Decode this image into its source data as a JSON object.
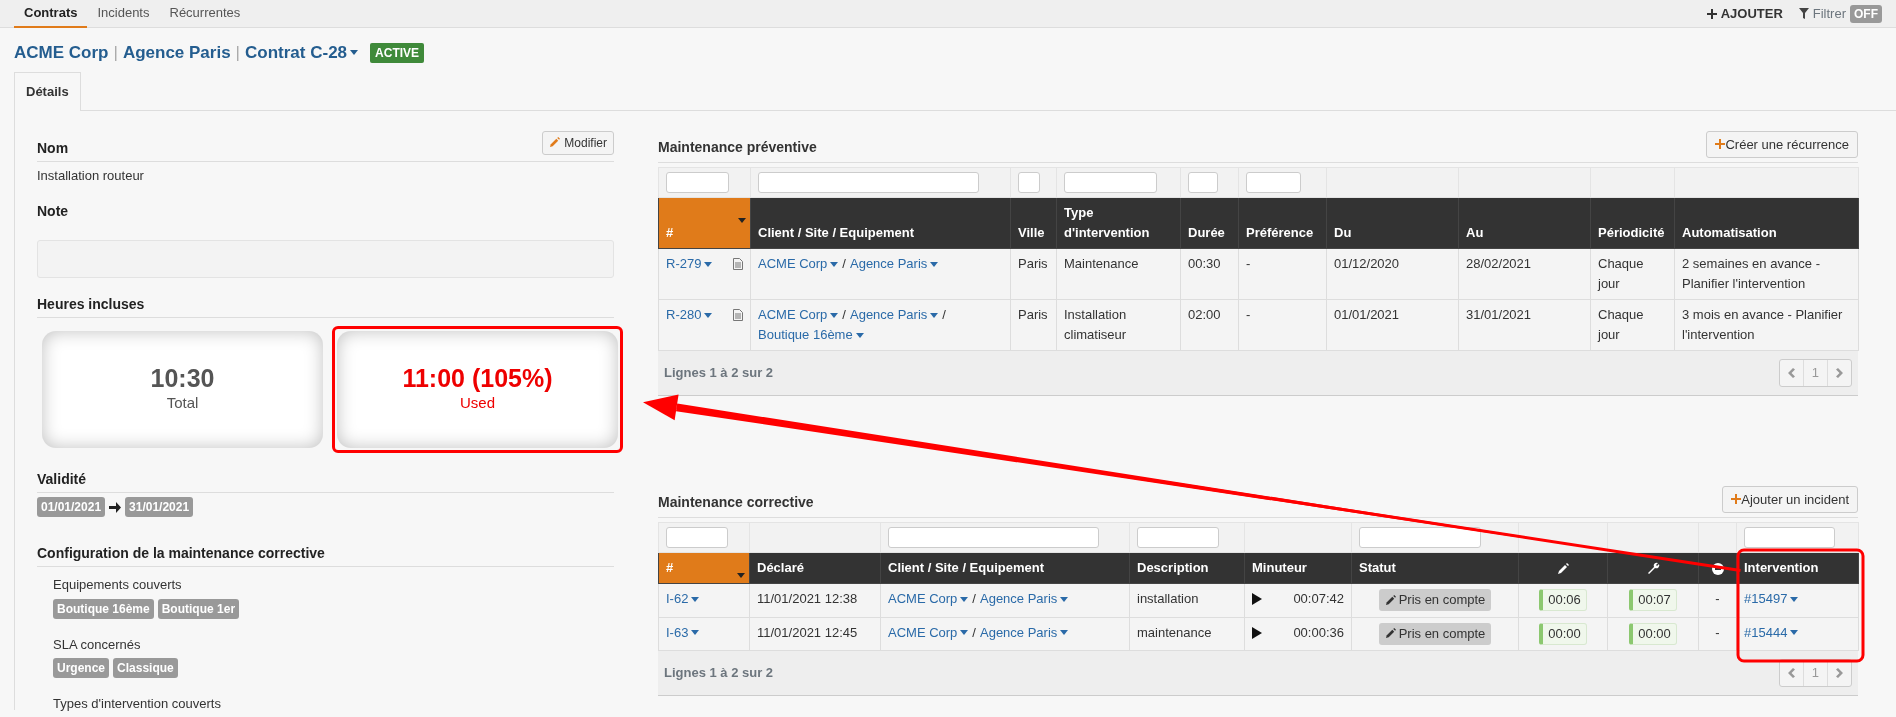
{
  "top_nav": {
    "tabs": [
      {
        "label": "Contrats",
        "selected": true
      },
      {
        "label": "Incidents",
        "selected": false
      },
      {
        "label": "Récurrentes",
        "selected": false
      }
    ],
    "add_button": "AJOUTER",
    "filter": {
      "label": "Filtrer",
      "on": false,
      "toggle_text": "OFF"
    }
  },
  "breadcrumb": {
    "items": [
      "ACME Corp",
      "Agence Paris",
      "Contrat C-28"
    ],
    "separator": "|",
    "status": "ACTIVE"
  },
  "detail_tabs": [
    {
      "label": "Détails",
      "selected": true
    }
  ],
  "details": {
    "name_label": "Nom",
    "edit_button": "Modifier",
    "name": "Installation routeur",
    "note_label": "Note",
    "hours_label": "Heures incluses",
    "hours": [
      {
        "value": "10:30",
        "caption": "Total",
        "over": false,
        "highlighted": false
      },
      {
        "value": "11:00 (105%)",
        "caption": "Used",
        "over": true,
        "highlighted": true
      }
    ],
    "validity_label": "Validité",
    "validity": {
      "start": "01/01/2021",
      "end": "31/01/2021"
    },
    "config_label": "Configuration de la maintenance corrective",
    "config_groups": [
      {
        "label": "Equipements couverts",
        "tags": [
          "Boutique 16ème",
          "Boutique 1er"
        ]
      },
      {
        "label": "SLA concernés",
        "tags": [
          "Urgence",
          "Classique"
        ]
      },
      {
        "label": "Types d'intervention couverts"
      }
    ]
  },
  "preventive": {
    "title": "Maintenance préventive",
    "action_button": "Créer une récurrence",
    "path_separator": "/",
    "columns": [
      {
        "kind": "text",
        "label": "#",
        "filter": true,
        "sorted": true
      },
      {
        "kind": "text",
        "label": "Client / Site / Equipement",
        "filter": true,
        "sorted": false
      },
      {
        "kind": "text",
        "label": "Ville",
        "filter": true,
        "sorted": false
      },
      {
        "kind": "text",
        "label": "Type d'intervention",
        "filter": true,
        "sorted": false
      },
      {
        "kind": "text",
        "label": "Durée",
        "filter": true,
        "sorted": false
      },
      {
        "kind": "text",
        "label": "Préférence",
        "filter": true,
        "sorted": false
      },
      {
        "kind": "text",
        "label": "Du",
        "filter": false,
        "sorted": false
      },
      {
        "kind": "text",
        "label": "Au",
        "filter": false,
        "sorted": false
      },
      {
        "kind": "text",
        "label": "Périodicité",
        "filter": false,
        "sorted": false
      },
      {
        "kind": "text",
        "label": "Automatisation",
        "filter": false,
        "sorted": false
      }
    ],
    "rows": [
      {
        "id": "R-279",
        "client": [
          "ACME Corp",
          "Agence Paris"
        ],
        "city": "Paris",
        "type": "Maintenance",
        "duration": "00:30",
        "preference": "-",
        "from": "01/12/2020",
        "to": "28/02/2021",
        "periodicity": "Chaque jour",
        "automation": "2 semaines en avance - Planifier l'intervention"
      },
      {
        "id": "R-280",
        "client": [
          "ACME Corp",
          "Agence Paris",
          "Boutique 16ème"
        ],
        "city": "Paris",
        "type": "Installation climatiseur",
        "duration": "02:00",
        "preference": "-",
        "from": "01/01/2021",
        "to": "31/01/2021",
        "periodicity": "Chaque jour",
        "automation": "3 mois en avance - Planifier l'intervention"
      }
    ],
    "footer": "Lignes 1 à 2 sur 2",
    "page": "1"
  },
  "corrective": {
    "title": "Maintenance corrective",
    "action_button": "Ajouter un incident",
    "path_separator": "/",
    "columns": [
      {
        "kind": "text",
        "label": "#",
        "filter": true,
        "sorted": true,
        "highlighted": false
      },
      {
        "kind": "text",
        "label": "Déclaré",
        "filter": false,
        "sorted": false,
        "highlighted": false
      },
      {
        "kind": "text",
        "label": "Client / Site / Equipement",
        "filter": true,
        "sorted": false,
        "highlighted": false
      },
      {
        "kind": "text",
        "label": "Description",
        "filter": true,
        "sorted": false,
        "highlighted": false
      },
      {
        "kind": "text",
        "label": "Minuteur",
        "filter": false,
        "sorted": false,
        "highlighted": false
      },
      {
        "kind": "text",
        "label": "Statut",
        "filter": true,
        "sorted": false,
        "highlighted": false
      },
      {
        "kind": "icon",
        "filter": false,
        "sorted": false,
        "highlighted": false
      },
      {
        "kind": "icon",
        "filter": false,
        "sorted": false,
        "highlighted": false
      },
      {
        "kind": "icon",
        "filter": false,
        "sorted": false,
        "highlighted": false
      },
      {
        "kind": "text",
        "label": "Intervention",
        "filter": true,
        "sorted": false,
        "highlighted": true
      }
    ],
    "rows": [
      {
        "id": "I-62",
        "declared": "11/01/2021 12:38",
        "client": [
          "ACME Corp",
          "Agence Paris"
        ],
        "description": "installation",
        "timer": "00:07:42",
        "status": "Pris en compte",
        "time_1": "00:06",
        "time_2": "00:07",
        "column_9": "-",
        "intervention": "#15497"
      },
      {
        "id": "I-63",
        "declared": "11/01/2021 12:45",
        "client": [
          "ACME Corp",
          "Agence Paris"
        ],
        "description": "maintenance",
        "timer": "00:00:36",
        "status": "Pris en compte",
        "time_1": "00:00",
        "time_2": "00:00",
        "column_9": "-",
        "intervention": "#15444"
      }
    ],
    "footer": "Lignes 1 à 2 sur 2",
    "page": "1"
  },
  "annotation_arrow": true
}
